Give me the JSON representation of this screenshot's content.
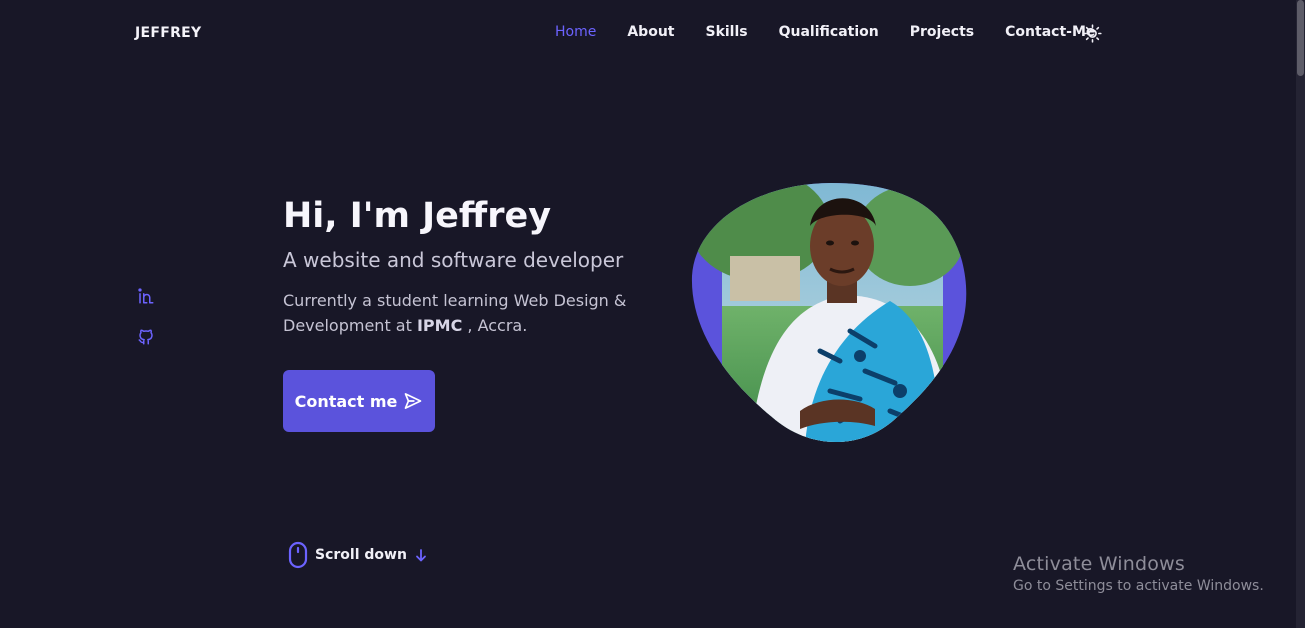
{
  "header": {
    "logo": "JEFFREY",
    "nav": [
      {
        "label": "Home",
        "active": true
      },
      {
        "label": "About",
        "active": false
      },
      {
        "label": "Skills",
        "active": false
      },
      {
        "label": "Qualification",
        "active": false
      },
      {
        "label": "Projects",
        "active": false
      },
      {
        "label": "Contact-Me",
        "active": false
      }
    ],
    "theme_toggle_icon": "sun-icon"
  },
  "social": [
    {
      "icon": "linkedin-icon"
    },
    {
      "icon": "github-icon"
    }
  ],
  "hero": {
    "title": "Hi, I'm Jeffrey",
    "subtitle": "A website and software developer",
    "description_prefix": "Currently a student learning Web Design & Development at ",
    "description_bold": "IPMC",
    "description_suffix": " , Accra.",
    "cta_label": "Contact me",
    "cta_icon": "send-icon"
  },
  "scroll_down": {
    "label": "Scroll down",
    "mouse_icon": "mouse-icon",
    "arrow_icon": "arrow-down-icon"
  },
  "watermark": {
    "title": "Activate Windows",
    "subtitle": "Go to Settings to activate Windows."
  },
  "colors": {
    "background": "#181727",
    "accent": "#5b53dc",
    "text": "#f1f0f7"
  }
}
